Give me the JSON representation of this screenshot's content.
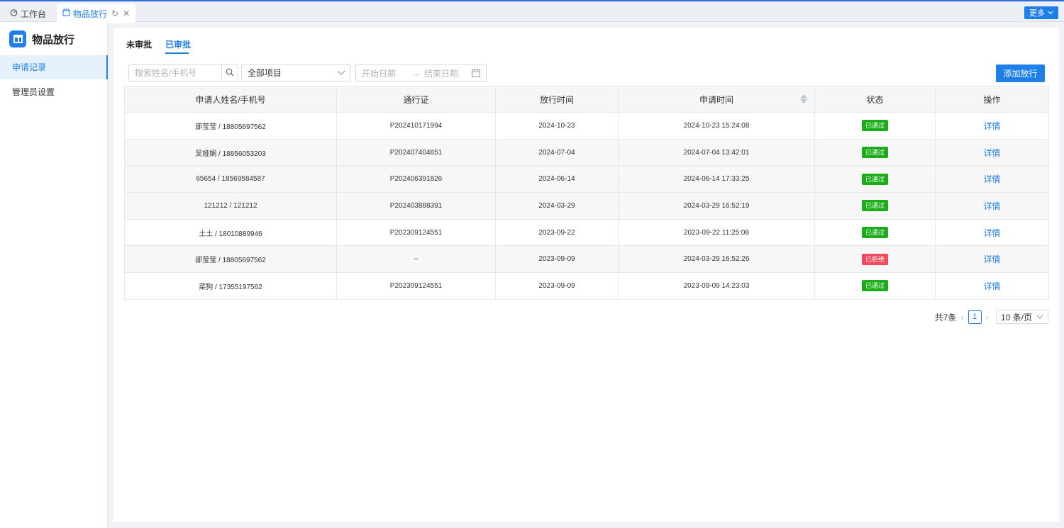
{
  "topbar": {
    "tabs": [
      {
        "label": "工作台",
        "icon": "dashboard-icon"
      },
      {
        "label": "物品放行",
        "icon": "box-icon"
      }
    ],
    "more_label": "更多"
  },
  "sidebar": {
    "title": "物品放行",
    "items": [
      {
        "label": "申请记录"
      },
      {
        "label": "管理员设置"
      }
    ]
  },
  "main": {
    "tabs": [
      {
        "label": "未审批"
      },
      {
        "label": "已审批"
      }
    ],
    "filters": {
      "search_placeholder": "搜索姓名/手机号",
      "project_select": "全部项目",
      "start_placeholder": "开始日期",
      "end_placeholder": "结束日期"
    },
    "add_button": "添加放行",
    "table": {
      "columns": [
        "申请人姓名/手机号",
        "通行证",
        "放行时间",
        "申请时间",
        "状态",
        "操作"
      ],
      "rows": [
        {
          "applicant": "邵莹莹 / 18805697562",
          "pass": "P202410171994",
          "release": "2024-10-23",
          "apply": "2024-10-23 15:24:08",
          "status": "已通过",
          "status_type": "ok",
          "action": "详情"
        },
        {
          "applicant": "吴娅娴 / 18856053203",
          "pass": "P202407404851",
          "release": "2024-07-04",
          "apply": "2024-07-04 13:42:01",
          "status": "已通过",
          "status_type": "ok",
          "action": "详情"
        },
        {
          "applicant": "65654 / 18569584587",
          "pass": "P202406391826",
          "release": "2024-06-14",
          "apply": "2024-06-14 17:33:25",
          "status": "已通过",
          "status_type": "ok",
          "action": "详情"
        },
        {
          "applicant": "121212 / 121212",
          "pass": "P202403888391",
          "release": "2024-03-29",
          "apply": "2024-03-29 16:52:19",
          "status": "已通过",
          "status_type": "ok",
          "action": "详情"
        },
        {
          "applicant": "土土 / 18010889946",
          "pass": "P202309124551",
          "release": "2023-09-22",
          "apply": "2023-09-22 11:25:08",
          "status": "已通过",
          "status_type": "ok",
          "action": "详情"
        },
        {
          "applicant": "邵莹莹 / 18805697562",
          "pass": "--",
          "release": "2023-09-09",
          "apply": "2024-03-29 16:52:26",
          "status": "已拒绝",
          "status_type": "no",
          "action": "详情"
        },
        {
          "applicant": "菜狗 / 17355197562",
          "pass": "P202309124551",
          "release": "2023-09-09",
          "apply": "2023-09-09 14:23:03",
          "status": "已通过",
          "status_type": "ok",
          "action": "详情"
        }
      ]
    },
    "pagination": {
      "total": "共7条",
      "current": "1",
      "page_size": "10 条/页"
    }
  },
  "colors": {
    "accent": "#1e7fe8",
    "approved": "#1aad19",
    "rejected": "#f04a5c"
  }
}
